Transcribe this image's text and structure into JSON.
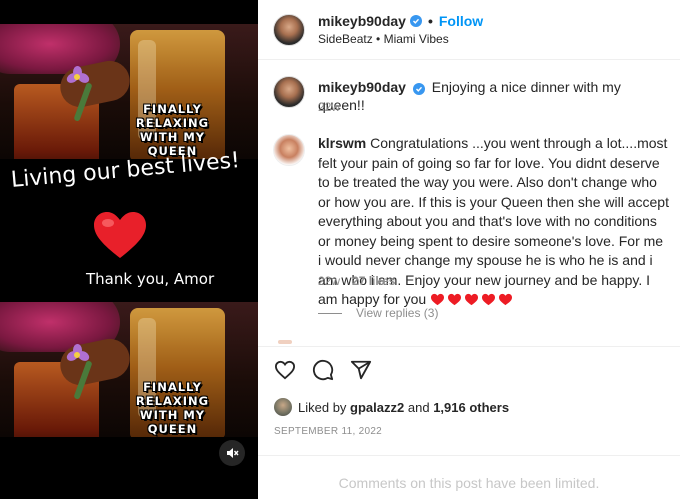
{
  "media": {
    "caption_top": "FINALLY RELAXING WITH MY QUEEN",
    "caption_bottom": "FINALLY RELAXING WITH MY QUEEN",
    "title_text": "Living our best lives!",
    "thanks_text": "Thank you, Amor",
    "mute_icon": "speaker-muted-icon"
  },
  "header": {
    "username": "mikeyb90day",
    "separator": "•",
    "follow_label": "Follow",
    "subtitle": "SideBeatz • Miami Vibes"
  },
  "post": {
    "username": "mikeyb90day",
    "caption": "Enjoying a nice dinner with my queen!!",
    "time": "22w"
  },
  "comment": {
    "username": "klrswm",
    "text": "Congratulations ...you went through a lot....most felt your pain of going so far for love. You didnt deserve to be treated the way you were. Also don't change who or how you are. If this is your Queen then she will accept everything about you and that's love with no conditions or money being spent to desire someone's love. For me i would never change my spouse he is who he is and i am who i am. Enjoy your new journey and be happy. I am happy for you",
    "heart_count": 5,
    "time": "22w",
    "likes": "27 likes",
    "replies_label": "View replies (3)"
  },
  "actions": {
    "like_icon": "heart-outline-icon",
    "comment_icon": "comment-bubble-icon",
    "share_icon": "paper-plane-icon"
  },
  "likes_summary": {
    "prefix": "Liked by",
    "user": "gpalazz2",
    "conjunction": "and",
    "others": "1,916 others"
  },
  "date": "SEPTEMBER 11, 2022",
  "comments_limited": "Comments on this post have been limited.",
  "colors": {
    "accent": "#0095f6",
    "verified": "#3897f0",
    "heart": "#ed1c24",
    "muted_text": "#8e8e8e"
  }
}
